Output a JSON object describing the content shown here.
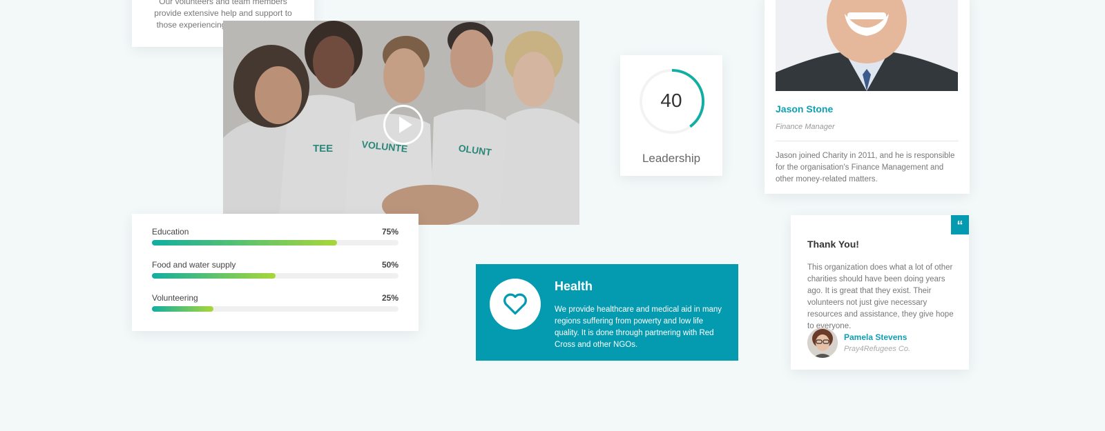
{
  "top_card": {
    "text": "Our volunteers and team members provide extensive help and support to those experiencing health problems."
  },
  "video": {
    "shirt_text_left": "TEE",
    "shirt_text_center": "VOLUNTE",
    "shirt_text_right": "OLUNT"
  },
  "progress": [
    {
      "label": "Education",
      "percent_label": "75%",
      "value": 75
    },
    {
      "label": "Food and water supply",
      "percent_label": "50%",
      "value": 50
    },
    {
      "label": "Volunteering",
      "percent_label": "25%",
      "value": 25
    }
  ],
  "leadership": {
    "value": "40",
    "label": "Leadership",
    "fraction": 0.4,
    "ring_color": "#12aea1"
  },
  "health": {
    "title": "Health",
    "text": "We provide healthcare and medical aid in many regions suffering from powerty and low life quality. It is done through partnering with Red Cross and other NGOs.",
    "icon": "heart-icon",
    "color": "#049ab0"
  },
  "person": {
    "name": "Jason Stone",
    "role": "Finance Manager",
    "bio": "Jason joined Charity in 2011, and he is responsible for the organisation's Finance Management and other money-related matters."
  },
  "testimonial": {
    "badge": "“",
    "title": "Thank You!",
    "text": "This organization does what a lot of other charities should have been doing years ago. It is great that they exist. Their volunteers not just give necessary resources and assistance, they give hope to everyone.",
    "author": "Pamela Stevens",
    "organization": "Pray4Refugees Co."
  },
  "colors": {
    "accent": "#049ab0",
    "link": "#0e9fb3",
    "gradient_start": "#12aea1",
    "gradient_end": "#a9d63a"
  }
}
